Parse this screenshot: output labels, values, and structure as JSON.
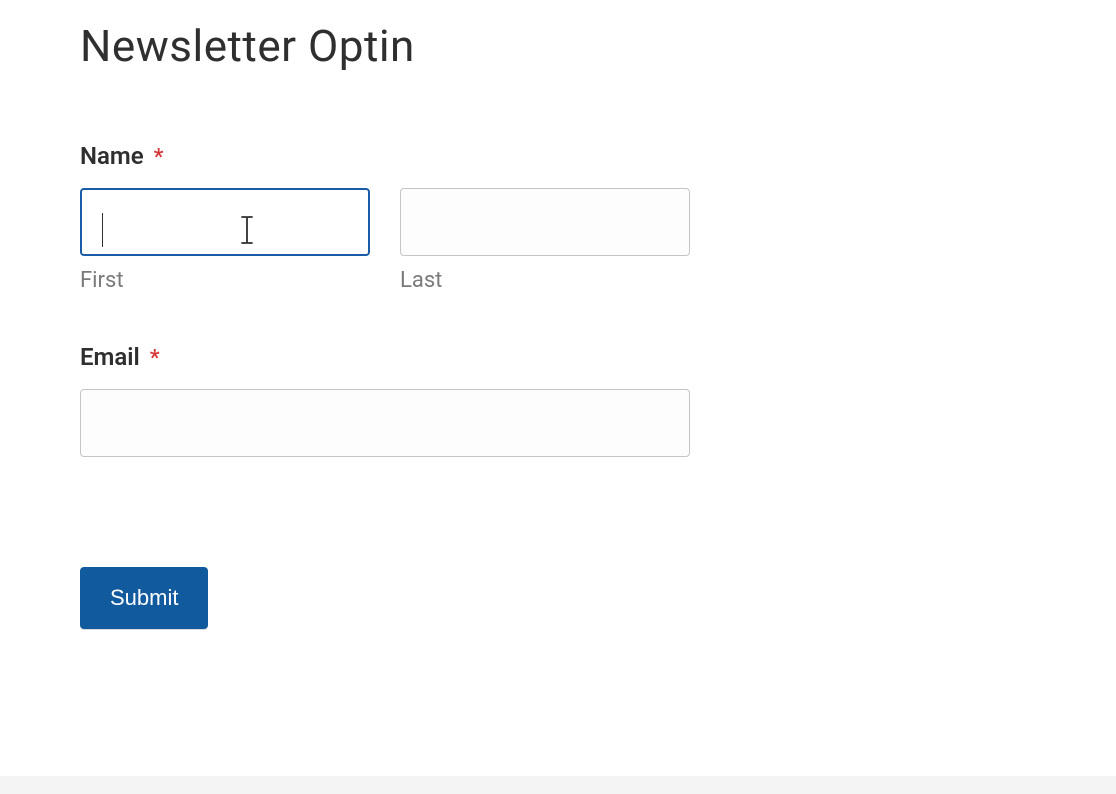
{
  "page": {
    "title": "Newsletter Optin"
  },
  "form": {
    "name": {
      "label": "Name",
      "required": "*",
      "first": {
        "value": "",
        "sublabel": "First"
      },
      "last": {
        "value": "",
        "sublabel": "Last"
      }
    },
    "email": {
      "label": "Email",
      "required": "*",
      "value": ""
    },
    "submit": {
      "label": "Submit"
    }
  }
}
